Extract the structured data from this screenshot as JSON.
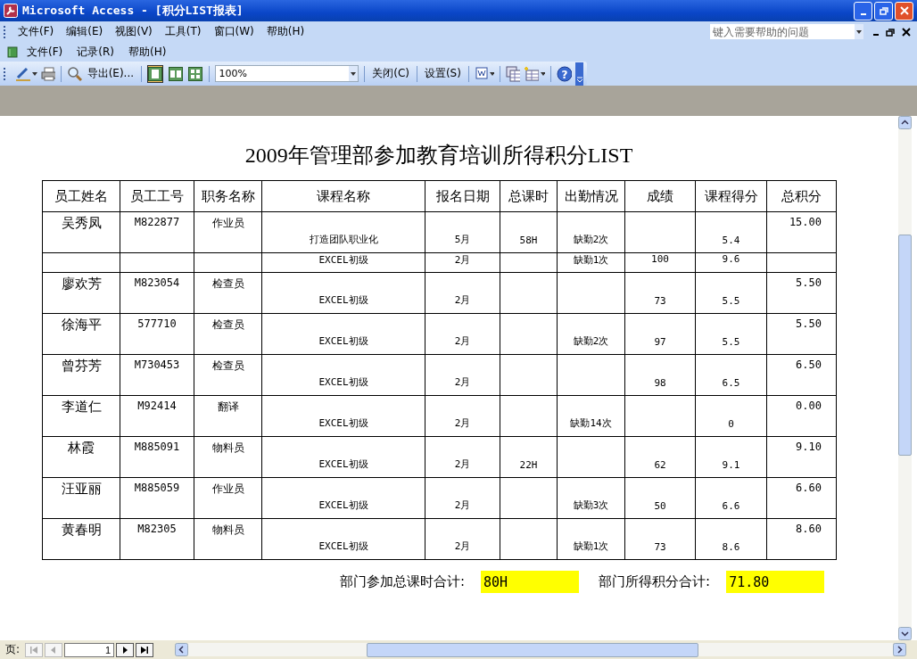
{
  "window": {
    "title": "Microsoft Access - [积分LIST报表]"
  },
  "menu_bar": [
    "文件(F)",
    "编辑(E)",
    "视图(V)",
    "工具(T)",
    "窗口(W)",
    "帮助(H)"
  ],
  "report_menu": [
    "文件(F)",
    "记录(R)",
    "帮助(H)"
  ],
  "help_box": {
    "placeholder": "键入需要帮助的问题"
  },
  "toolbar": [
    {
      "kind": "view",
      "dropdown": true
    },
    {
      "kind": "print"
    },
    {
      "kind": "sep"
    },
    {
      "kind": "zoom-tool"
    },
    {
      "kind": "text",
      "label": "导出(E)..."
    },
    {
      "kind": "sep"
    },
    {
      "kind": "one-page",
      "selected": true
    },
    {
      "kind": "two-pages",
      "selected": false
    },
    {
      "kind": "multi-page",
      "selected": false
    },
    {
      "kind": "sep"
    },
    {
      "kind": "combo",
      "value": "100%"
    },
    {
      "kind": "sep"
    },
    {
      "kind": "text",
      "label": "关闭(C)"
    },
    {
      "kind": "sep"
    },
    {
      "kind": "text",
      "label": "设置(S)"
    },
    {
      "kind": "sep"
    },
    {
      "kind": "word",
      "dropdown": true
    },
    {
      "kind": "sep"
    },
    {
      "kind": "db-window"
    },
    {
      "kind": "new-object",
      "dropdown": true
    },
    {
      "kind": "sep"
    },
    {
      "kind": "help",
      "glyph": "?"
    }
  ],
  "report": {
    "title": "2009年管理部参加教育培训所得积分LIST",
    "columns": [
      "员工姓名",
      "员工工号",
      "职务名称",
      "课程名称",
      "报名日期",
      "总课时",
      "出勤情况",
      "成绩",
      "课程得分",
      "总积分"
    ],
    "employees": [
      {
        "name": "吴秀凤",
        "id": "M822877",
        "position": "作业员",
        "total": "15.00",
        "courses": [
          {
            "course": "打造团队职业化",
            "month": "5月",
            "hours": "58H",
            "attendance": "缺勤2次",
            "points": "5.4"
          },
          {
            "course": "EXCEL初级",
            "month": "2月",
            "attendance": "缺勤1次",
            "score": "100",
            "points": "9.6"
          }
        ]
      },
      {
        "name": "廖欢芳",
        "id": "M823054",
        "position": "检查员",
        "total": "5.50",
        "courses": [
          {
            "course": "EXCEL初级",
            "month": "2月",
            "score": "73",
            "points": "5.5"
          }
        ]
      },
      {
        "name": "徐海平",
        "id": "577710",
        "position": "检查员",
        "total": "5.50",
        "courses": [
          {
            "course": "EXCEL初级",
            "month": "2月",
            "attendance": "缺勤2次",
            "score": "97",
            "points": "5.5"
          }
        ]
      },
      {
        "name": "曾芬芳",
        "id": "M730453",
        "position": "检查员",
        "total": "6.50",
        "courses": [
          {
            "course": "EXCEL初级",
            "month": "2月",
            "score": "98",
            "points": "6.5"
          }
        ]
      },
      {
        "name": "李道仁",
        "id": "M92414",
        "position": "翻译",
        "total": "0.00",
        "courses": [
          {
            "course": "EXCEL初级",
            "month": "2月",
            "attendance": "缺勤14次",
            "points": "0"
          }
        ]
      },
      {
        "name": "林霞",
        "id": "M885091",
        "position": "物料员",
        "total": "9.10",
        "courses": [
          {
            "course": "EXCEL初级",
            "month": "2月",
            "hours": "22H",
            "score": "62",
            "points": "9.1"
          }
        ]
      },
      {
        "name": "汪亚丽",
        "id": "M885059",
        "position": "作业员",
        "total": "6.60",
        "courses": [
          {
            "course": "EXCEL初级",
            "month": "2月",
            "attendance": "缺勤3次",
            "score": "50",
            "points": "6.6"
          }
        ]
      },
      {
        "name": "黄春明",
        "id": "M82305",
        "position": "物料员",
        "total": "8.60",
        "courses": [
          {
            "course": "EXCEL初级",
            "month": "2月",
            "attendance": "缺勤1次",
            "score": "73",
            "points": "8.6"
          }
        ]
      }
    ],
    "totals": [
      {
        "label": "部门参加总课时合计:",
        "value": "80H"
      },
      {
        "label": "部门所得积分合计:",
        "value": "71.80"
      }
    ]
  },
  "page_nav": {
    "label": "页:",
    "page": "1",
    "buttons": [
      {
        "kind": "first",
        "disabled": true
      },
      {
        "kind": "prev",
        "disabled": true
      },
      {
        "kind": "next",
        "disabled": false
      },
      {
        "kind": "last",
        "disabled": false
      }
    ]
  }
}
